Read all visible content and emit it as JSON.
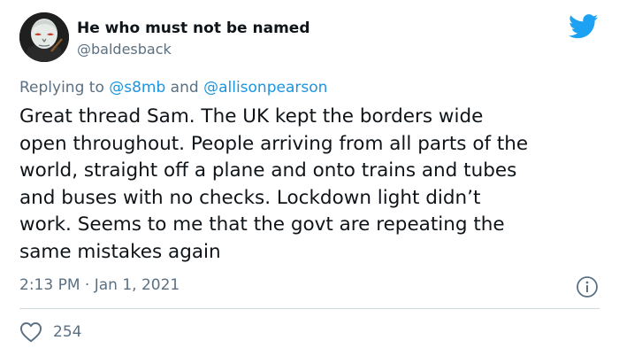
{
  "author": {
    "display_name": "He who must not be named",
    "handle": "@baldesback",
    "avatar_icon": "voldemort-avatar"
  },
  "reply": {
    "prefix": "Replying to ",
    "mention_1": "@s8mb",
    "separator": " and ",
    "mention_2": "@allisonpearson"
  },
  "tweet": {
    "text": "Great thread Sam. The UK kept the borders wide\nopen throughout. People arriving from all parts of the\nworld, straight off a plane and onto trains and tubes\nand buses with no checks. Lockdown light didn’t\nwork. Seems to me that the govt are repeating the\nsame mistakes again",
    "timestamp": "2:13 PM · Jan 1, 2021"
  },
  "engagement": {
    "likes": "254"
  },
  "icons": {
    "brand": "twitter-bird-icon",
    "info": "info-icon",
    "like": "heart-icon"
  },
  "colors": {
    "twitter_blue": "#1da1f2",
    "link_blue": "#1b95e0",
    "secondary_text": "#5b7083",
    "divider": "#cfd9de"
  }
}
